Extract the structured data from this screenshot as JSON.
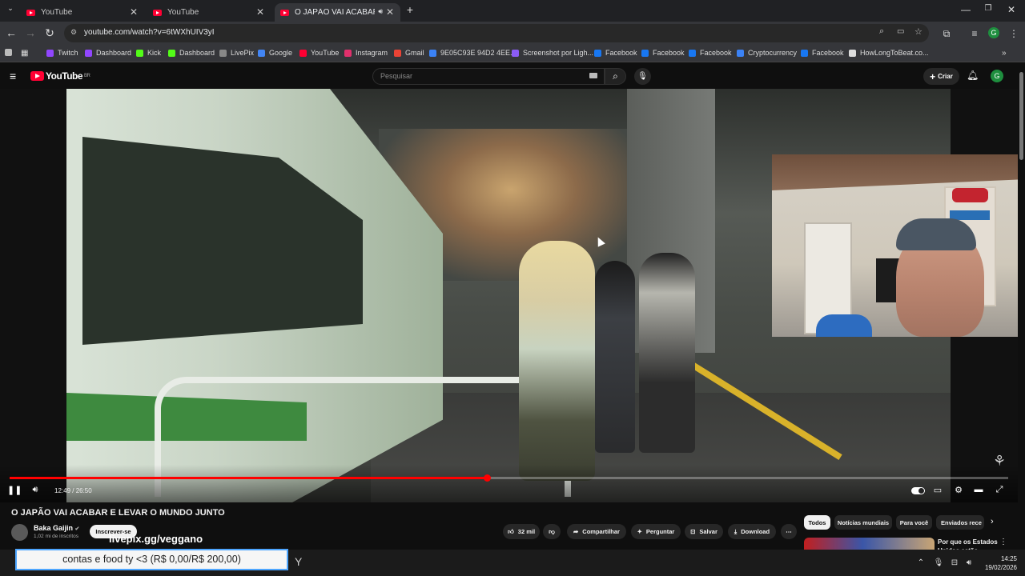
{
  "browser": {
    "tabs": [
      {
        "title": "YouTube"
      },
      {
        "title": "YouTube"
      },
      {
        "title": "O JAPÃO VAI ACABAR E LEV"
      }
    ],
    "new_tab": "+",
    "address": "youtube.com/watch?v=6tWXhUIV3yI",
    "bookmarks": [
      {
        "label": "Twitch",
        "color": "#9146ff"
      },
      {
        "label": "Dashboard",
        "color": "#9146ff"
      },
      {
        "label": "Kick",
        "color": "#53fc18"
      },
      {
        "label": "Dashboard",
        "color": "#53fc18"
      },
      {
        "label": "LivePix",
        "color": "#888888"
      },
      {
        "label": "Google",
        "color": "#4285f4"
      },
      {
        "label": "YouTube",
        "color": "#ff0033"
      },
      {
        "label": "Instagram",
        "color": "#e1306c"
      },
      {
        "label": "Gmail",
        "color": "#ea4335"
      },
      {
        "label": "9E05C93E 94D2 4EE...",
        "color": "#3b82f6"
      },
      {
        "label": "Screenshot por Ligh...",
        "color": "#8b5cf6"
      },
      {
        "label": "Facebook",
        "color": "#1877f2"
      },
      {
        "label": "Facebook",
        "color": "#1877f2"
      },
      {
        "label": "Facebook",
        "color": "#1877f2"
      },
      {
        "label": "Cryptocurrency",
        "color": "#3b82f6"
      },
      {
        "label": "Facebook",
        "color": "#1877f2"
      },
      {
        "label": "HowLongToBeat.co...",
        "color": "#dddddd"
      }
    ],
    "profile_initial": "G"
  },
  "youtube": {
    "logo_text": "YouTube",
    "logo_sup": "BR",
    "search_placeholder": "Pesquisar",
    "create_label": "Criar",
    "avatar_initial": "G"
  },
  "player": {
    "time": "12:49 / 26:50",
    "progress_fraction": 0.478
  },
  "video": {
    "title": "O JAPÃO VAI ACABAR E LEVAR O MUNDO JUNTO",
    "channel": "Baka Gaijin",
    "subscribers": "1,02 mi de inscritos",
    "subscribe_label": "Inscrever-se",
    "promo": "livepix.gg/veggano",
    "likes": "32 mil",
    "share_label": "Compartilhar",
    "ask_label": "Perguntar",
    "save_label": "Salvar",
    "download_label": "Download"
  },
  "sidebar": {
    "chips": [
      "Todos",
      "Notícias mundiais",
      "Para você",
      "Enviados rece"
    ],
    "rec_title": "Por que os Estados Unidos estão..."
  },
  "overlay": {
    "text": "contas e food ty <3 (R$ 0,00/R$ 200,00)"
  },
  "taskbar": {
    "time": "14:25",
    "date": "19/02/2026"
  }
}
